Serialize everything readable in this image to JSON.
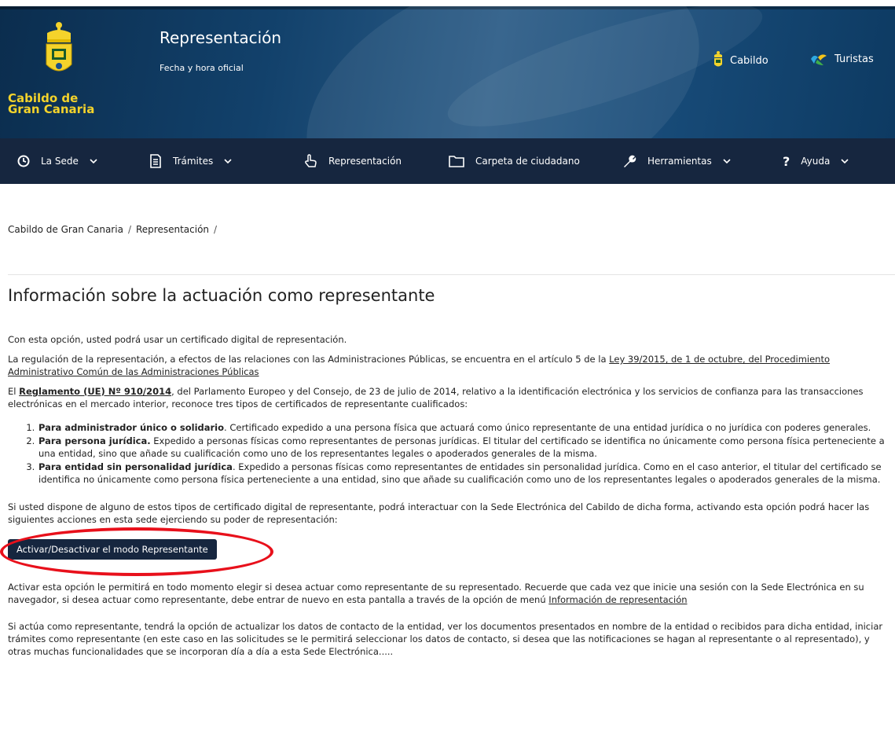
{
  "header": {
    "logo_line1": "Cabildo de",
    "logo_line2": "Gran Canaria",
    "title": "Representación",
    "subtitle": "Fecha y hora oficial",
    "links": {
      "cabildo": "Cabildo",
      "turistas": "Turistas"
    },
    "colors": {
      "header_bg": "#12416b",
      "logo_text": "#f4d32b",
      "nav_bg": "#16263f"
    }
  },
  "nav": {
    "items": [
      {
        "label": "La Sede",
        "icon": "clock-icon",
        "dropdown": true
      },
      {
        "label": "Trámites",
        "icon": "document-icon",
        "dropdown": true
      },
      {
        "label": "Representación",
        "icon": "hand-pointer-icon",
        "dropdown": false
      },
      {
        "label": "Carpeta de ciudadano",
        "icon": "folder-icon",
        "dropdown": false
      },
      {
        "label": "Herramientas",
        "icon": "wrench-icon",
        "dropdown": true
      },
      {
        "label": "Ayuda",
        "icon": "question-icon",
        "dropdown": true
      }
    ]
  },
  "breadcrumb": {
    "home": "Cabildo de Gran Canaria",
    "current": "Representación",
    "separator": "/"
  },
  "main": {
    "heading": "Información sobre la actuación como representante",
    "p1": "Con esta opción, usted podrá usar un certificado digital de representación.",
    "p2_text": "La regulación de la representación, a efectos de las relaciones con las Administraciones Públicas, se encuentra en el artículo 5 de la ",
    "p2_link": "Ley 39/2015, de 1 de octubre, del Procedimiento Administrativo Común de las Administraciones Públicas",
    "p3_pre": "El ",
    "p3_link": "Reglamento (UE) Nº 910/2014",
    "p3_post": ", del Parlamento Europeo y del Consejo, de 23 de julio de 2014, relativo a la identificación electrónica y los servicios de confianza para las transacciones electrónicas en el mercado interior, reconoce tres tipos de certificados de representante cualificados:",
    "list": [
      {
        "bold": "Para administrador único o solidario",
        "text": ". Certificado expedido a una persona física que actuará como único representante de una entidad jurídica o no jurídica con poderes generales."
      },
      {
        "bold": "Para persona jurídica.",
        "text": " Expedido a personas físicas como representantes de personas jurídicas. El titular del certificado se identifica no únicamente como persona física perteneciente a una entidad, sino que añade su cualificación como uno de los representantes legales o apoderados generales de la misma."
      },
      {
        "bold": "Para entidad sin personalidad jurídica",
        "text": ". Expedido a personas físicas como representantes de entidades sin personalidad jurídica. Como en el caso anterior, el titular del certificado se identifica no únicamente como persona física perteneciente a una entidad, sino que añade su cualificación como uno de los representantes legales o apoderados generales de la misma."
      }
    ],
    "p4": "Si usted dispone de alguno de estos tipos de certificado digital de representante, podrá interactuar con la Sede Electrónica del Cabildo de dicha forma, activando esta opción podrá hacer las siguientes acciones en esta sede ejerciendo su poder de representación:",
    "button_label": "Activar/Desactivar el modo Representante",
    "highlight_color": "#e8101b",
    "p5_text": "Activar esta opción le permitirá en todo momento elegir si desea actuar como representante de su representado. Recuerde que cada vez que inicie una sesión con la Sede Electrónica en su navegador, si desea actuar como representante, debe entrar de nuevo en esta pantalla a través de la opción de menú ",
    "p5_link": "Información de representación",
    "p6": "Si actúa como representante, tendrá la opción de actualizar los datos de contacto de la entidad, ver los documentos presentados en nombre de la entidad o recibidos para dicha entidad, iniciar trámites como representante (en este caso en las solicitudes se le permitirá seleccionar los datos de contacto, si desea que las notificaciones se hagan al representante o al representado), y otras muchas funcionalidades que se incorporan día a día a esta Sede Electrónica....."
  }
}
